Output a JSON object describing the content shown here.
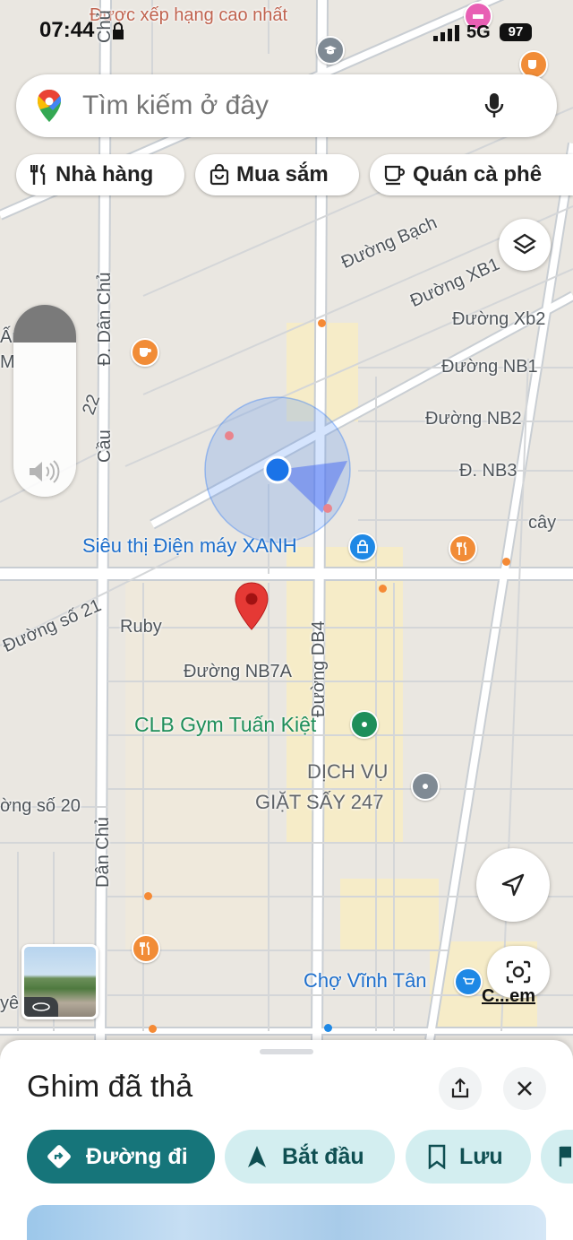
{
  "status_bar": {
    "time": "07:44",
    "network": "5G",
    "battery": "97"
  },
  "search": {
    "placeholder": "Tìm kiếm ở đây"
  },
  "chips": [
    {
      "label": "Nhà hàng",
      "icon": "fork-knife-icon"
    },
    {
      "label": "Mua sắm",
      "icon": "shopping-bag-icon"
    },
    {
      "label": "Quán cà phê",
      "icon": "coffee-cup-icon"
    }
  ],
  "map_labels": {
    "top_banner": "Được xếp hạng cao nhất",
    "chu_top": "Chủ",
    "dan_chu_1": "Đ. Dân Chủ",
    "cau": "Cầu",
    "n22": "22",
    "duong_bach": "Đường Bạch",
    "xb1": "Đường XB1",
    "xb2": "Đường Xb2",
    "nb1": "Đường NB1",
    "nb2": "Đường NB2",
    "nb3": "Đ. NB3",
    "cay": "cây",
    "so21": "Đường số 21",
    "ruby": "Ruby",
    "nb7a": "Đường NB7A",
    "db4": "Đường DB4",
    "so20": "ờng số 20",
    "dan_chu_2": "Dân Chủ",
    "ye": "yê",
    "left_fragment": "Ấn\nM"
  },
  "pois": {
    "dien_may_xanh": "Siêu thị Điện máy XANH",
    "gym": "CLB Gym Tuấn Kiệt",
    "giat_say_line1": "DỊCH VỤ",
    "giat_say_line2": "GIẶT SẤY 247",
    "cho_vinh_tan": "Chợ Vĩnh Tân"
  },
  "lens_label": "C...em",
  "colors": {
    "brand_blue": "#1a73e8",
    "teal": "#16757a",
    "light_teal": "#d3eef0",
    "pin_red": "#d93025",
    "store_blue": "#1e88e5",
    "poi_orange": "#f18c37",
    "gym_green": "#1e8e5a"
  },
  "sheet": {
    "title": "Ghim đã thả",
    "buttons": [
      {
        "label": "Đường đi",
        "icon": "directions-icon"
      },
      {
        "label": "Bắt đầu",
        "icon": "navigation-arrow-icon"
      },
      {
        "label": "Lưu",
        "icon": "bookmark-icon"
      }
    ]
  }
}
